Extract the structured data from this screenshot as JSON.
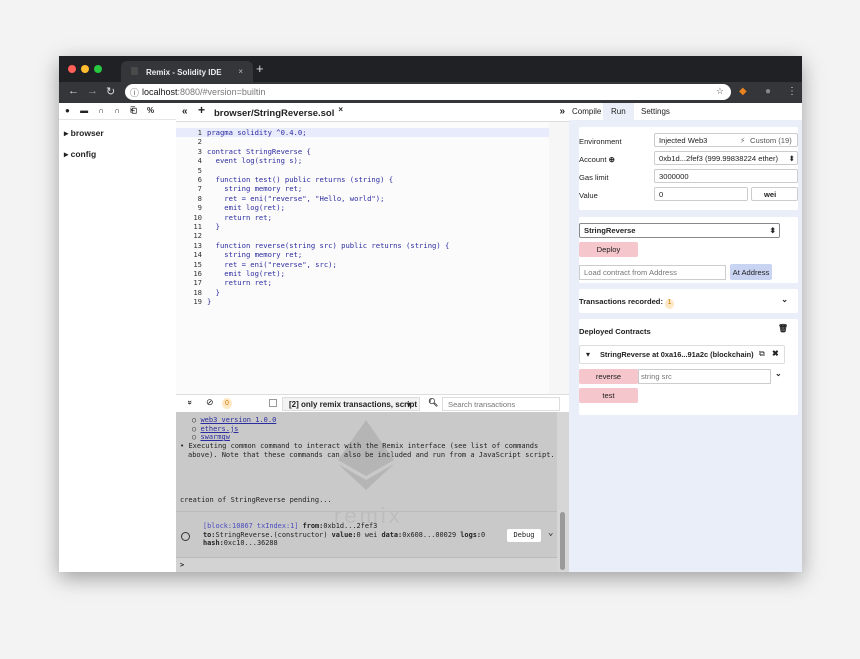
{
  "browser": {
    "tab_title": "Remix - Solidity IDE",
    "tab_close": "×",
    "new_tab": "+",
    "url_host": "localhost",
    "url_rest": ":8080/#version=builtin"
  },
  "left_panel": {
    "toolbar_icons": [
      "●",
      "▬",
      "∩",
      "∩",
      "⎗",
      "%"
    ],
    "items": [
      {
        "label": "browser"
      },
      {
        "label": "config"
      }
    ]
  },
  "editor": {
    "collapse": "«",
    "add": "+",
    "tab_label": "browser/StringReverse.sol",
    "tab_close": "×",
    "expand_right": "»",
    "lines": [
      {
        "n": "1",
        "text": "pragma solidity ^0.4.0;"
      },
      {
        "n": "2",
        "text": ""
      },
      {
        "n": "3",
        "text": "contract StringReverse {"
      },
      {
        "n": "4",
        "text": "  event log(string s);"
      },
      {
        "n": "5",
        "text": ""
      },
      {
        "n": "6",
        "text": "  function test() public returns (string) {"
      },
      {
        "n": "7",
        "text": "    string memory ret;"
      },
      {
        "n": "8",
        "text": "    ret = eni(\"reverse\", \"Hello, world\");"
      },
      {
        "n": "9",
        "text": "    emit log(ret);"
      },
      {
        "n": "10",
        "text": "    return ret;"
      },
      {
        "n": "11",
        "text": "  }"
      },
      {
        "n": "12",
        "text": ""
      },
      {
        "n": "13",
        "text": "  function reverse(string src) public returns (string) {"
      },
      {
        "n": "14",
        "text": "    string memory ret;"
      },
      {
        "n": "15",
        "text": "    ret = eni(\"reverse\", src);"
      },
      {
        "n": "16",
        "text": "    emit log(ret);"
      },
      {
        "n": "17",
        "text": "    return ret;"
      },
      {
        "n": "18",
        "text": "  }"
      },
      {
        "n": "19",
        "text": "}"
      }
    ]
  },
  "terminal_toolbar": {
    "collapse": "»",
    "clear": "⊘",
    "pending_count": "0",
    "filter_label": "[2] only remix transactions, script",
    "search_placeholder": "Search transactions"
  },
  "terminal": {
    "links": [
      "web3 version 1.0.0",
      "ethers.js",
      "swarmgw"
    ],
    "message": "Executing common command to interact with the Remix interface (see list of commands above). Note that these commands can also be included and run from a JavaScript script.",
    "pending": "creation of StringReverse pending...",
    "watermark": "remix",
    "tx_block": "[block:10867 txIndex:1]",
    "tx_from_label": "from:",
    "tx_from": "0xb1d...2fef3",
    "tx_to_label": "to:",
    "tx_to": "StringReverse.(constructor)",
    "tx_value_label": "value:",
    "tx_value": "0 wei",
    "tx_data_label": "data:",
    "tx_data": "0x608...00029",
    "tx_logs_label": "logs:",
    "tx_logs": "0",
    "tx_hash_label": "hash:",
    "tx_hash": "0xc10...36288",
    "debug_label": "Debug",
    "prompt": ">"
  },
  "run_panel": {
    "tabs": [
      "Compile",
      "Run",
      "Settings"
    ],
    "env_label": "Environment",
    "env_value": "Injected Web3",
    "env_custom": "Custom (19)",
    "account_label": "Account",
    "account_value": "0xb1d...2fef3 (999.99838224 ether)",
    "gas_label": "Gas limit",
    "gas_value": "3000000",
    "value_label": "Value",
    "value_value": "0",
    "value_unit": "wei",
    "contract_select": "StringReverse",
    "deploy_label": "Deploy",
    "load_placeholder": "Load contract from Address",
    "at_address_label": "At Address",
    "tx_recorded_label": "Transactions recorded:",
    "tx_recorded_count": "1",
    "deployed_title": "Deployed Contracts",
    "instance_label": "StringReverse at 0xa16...91a2c (blockchain)",
    "reverse_label": "reverse",
    "reverse_placeholder": "string src",
    "test_label": "test"
  }
}
